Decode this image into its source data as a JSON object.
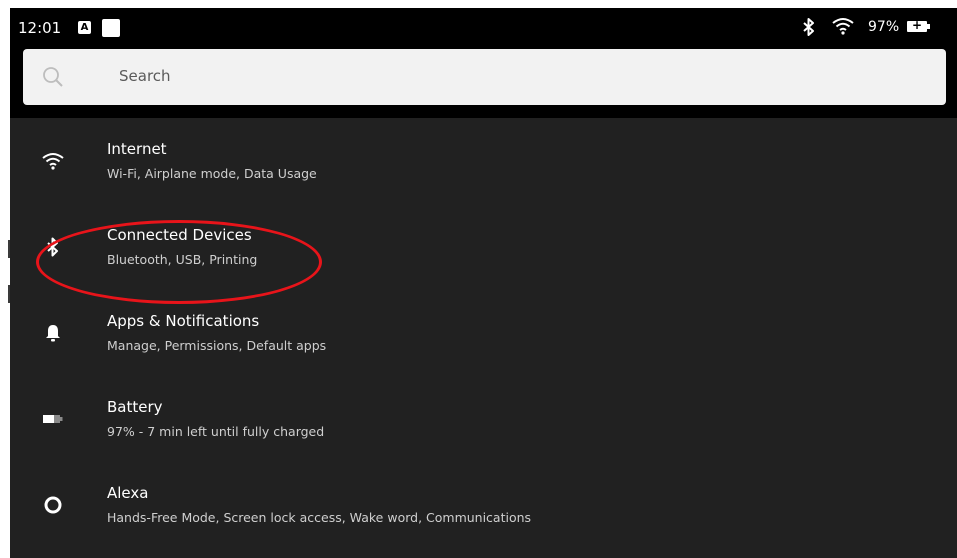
{
  "status_bar": {
    "time": "12:01",
    "notification_letter": "A",
    "battery_percent": "97%",
    "icons": [
      "bluetooth-icon",
      "wifi-icon",
      "battery-charging-icon"
    ]
  },
  "search": {
    "placeholder": "Search"
  },
  "settings": [
    {
      "title": "Internet",
      "subtitle": "Wi-Fi, Airplane mode, Data Usage",
      "icon": "wifi-icon"
    },
    {
      "title": "Connected Devices",
      "subtitle": "Bluetooth, USB, Printing",
      "icon": "bluetooth-icon"
    },
    {
      "title": "Apps & Notifications",
      "subtitle": "Manage, Permissions, Default apps",
      "icon": "bell-icon"
    },
    {
      "title": "Battery",
      "subtitle": "97% - 7 min left until fully charged",
      "icon": "battery-icon"
    },
    {
      "title": "Alexa",
      "subtitle": "Hands-Free Mode, Screen lock access, Wake word, Communications",
      "icon": "alexa-icon"
    }
  ],
  "colors": {
    "background": "#212121",
    "status_bar": "#000000",
    "search_bar": "#f2f2f2",
    "highlight": "#e8141a"
  }
}
